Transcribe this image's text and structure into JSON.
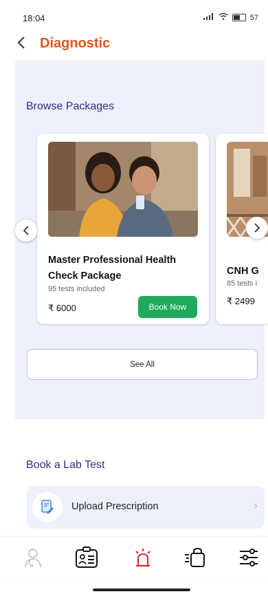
{
  "status": {
    "time": "18:04",
    "battery": "57"
  },
  "header": {
    "title": "Diagnostic"
  },
  "browse": {
    "title": "Browse Packages",
    "cards": [
      {
        "name": "Master Professional Health Check Package",
        "tests": "95 tests included",
        "price": "₹ 6000",
        "button": "Book Now"
      },
      {
        "name": "CNH G",
        "tests": "85 tests i",
        "price": "₹ 2499"
      }
    ],
    "see_all": "See All"
  },
  "lab": {
    "title": "Book a Lab Test",
    "upload_label": "Upload Prescription"
  },
  "colors": {
    "accent": "#e2571b",
    "section_title": "#2b2f86",
    "book_button": "#1faa59",
    "section_bg": "#eef0fb"
  },
  "nav_icons": [
    "doctor-icon",
    "id-card-icon",
    "emergency-siren-icon",
    "shopping-bag-icon",
    "filter-icon"
  ]
}
